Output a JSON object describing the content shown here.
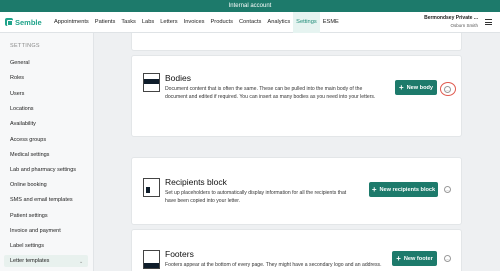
{
  "banner": {
    "text": "Internal account"
  },
  "app": {
    "brand": "Semble"
  },
  "nav": {
    "items": [
      {
        "label": "Appointments"
      },
      {
        "label": "Patients"
      },
      {
        "label": "Tasks"
      },
      {
        "label": "Labs"
      },
      {
        "label": "Letters"
      },
      {
        "label": "Invoices"
      },
      {
        "label": "Products"
      },
      {
        "label": "Contacts"
      },
      {
        "label": "Analytics"
      },
      {
        "label": "Settings",
        "active": true
      },
      {
        "label": "ESME"
      }
    ]
  },
  "account": {
    "org": "Bermondsey Private ...",
    "user": "Osborn Smith"
  },
  "sidebar": {
    "heading": "SETTINGS",
    "items": [
      {
        "label": "General"
      },
      {
        "label": "Roles"
      },
      {
        "label": "Users"
      },
      {
        "label": "Locations"
      },
      {
        "label": "Availability"
      },
      {
        "label": "Access groups"
      },
      {
        "label": "Medical settings"
      },
      {
        "label": "Lab and pharmacy settings"
      },
      {
        "label": "Online booking"
      },
      {
        "label": "SMS and email templates"
      },
      {
        "label": "Patient settings"
      },
      {
        "label": "Invoice and payment"
      },
      {
        "label": "Label settings"
      },
      {
        "label": "Letter templates",
        "active": true
      }
    ]
  },
  "cards": {
    "bodies": {
      "title": "Bodies",
      "desc_line1": "Document content that is often the same. These can be pulled into the main body of the",
      "desc_line2": "document and edited if required. You can insert as many bodies as you need into your letters.",
      "button": "New body",
      "more": "…"
    },
    "recipients": {
      "title": "Recipients block",
      "desc_line1": "Set up placeholders to automatically display information for all the recipients that",
      "desc_line2": "have been copied into your letter.",
      "button": "New recipients block",
      "more": "…"
    },
    "footers": {
      "title": "Footers",
      "desc_line1": "Footers appear at the bottom of every page. They might have a secondary logo and an address.",
      "button": "New footer",
      "more": "…"
    }
  },
  "colors": {
    "accent": "#1d7a6b",
    "brand": "#1fa38a",
    "highlight": "#e05a4f"
  }
}
